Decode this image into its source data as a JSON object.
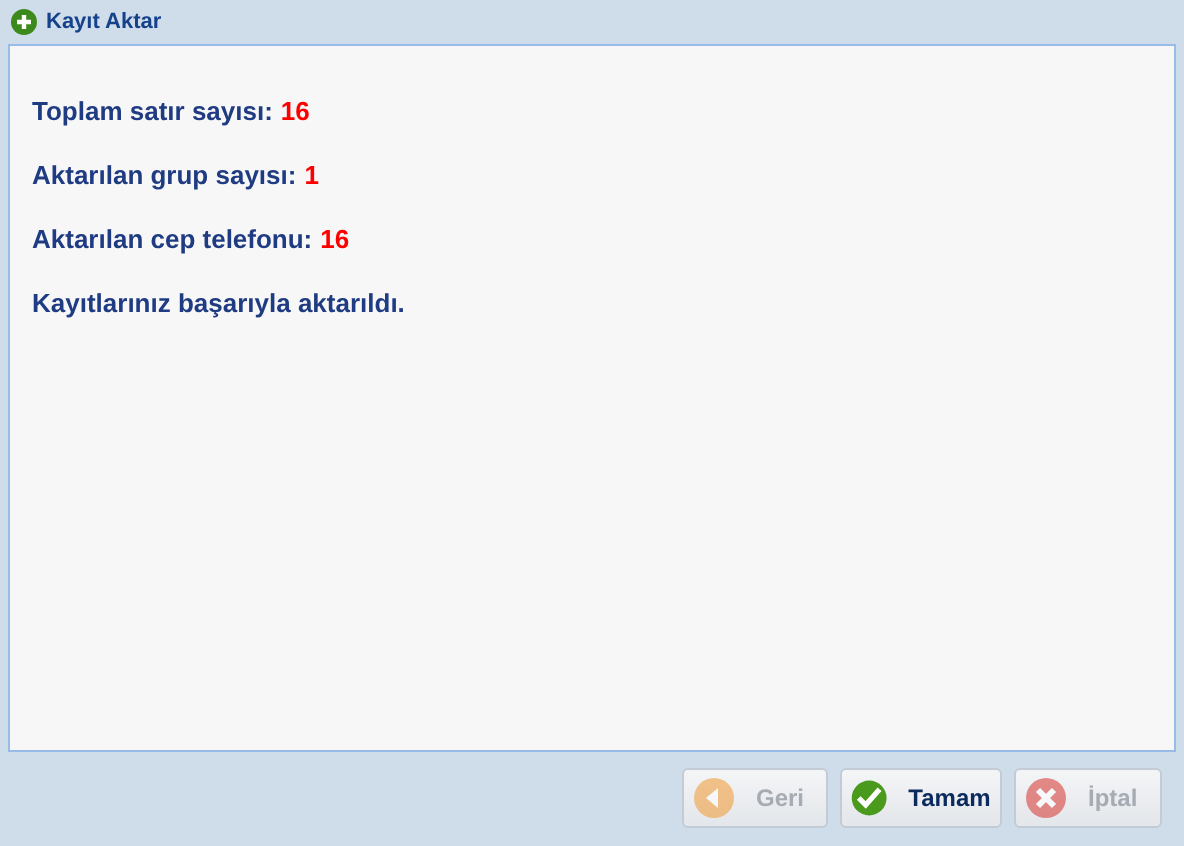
{
  "window": {
    "title": "Kayıt Aktar"
  },
  "stats": [
    {
      "label": "Toplam satır sayısı:",
      "value": "16"
    },
    {
      "label": "Aktarılan grup sayısı:",
      "value": "1"
    },
    {
      "label": "Aktarılan cep telefonu:",
      "value": "16"
    }
  ],
  "message": "Kayıtlarınız başarıyla aktarıldı.",
  "buttons": [
    {
      "label": "Geri",
      "kind": "back",
      "disabled": true
    },
    {
      "label": "Tamam",
      "kind": "ok",
      "disabled": false
    },
    {
      "label": "İptal",
      "kind": "cancel",
      "disabled": true
    }
  ]
}
